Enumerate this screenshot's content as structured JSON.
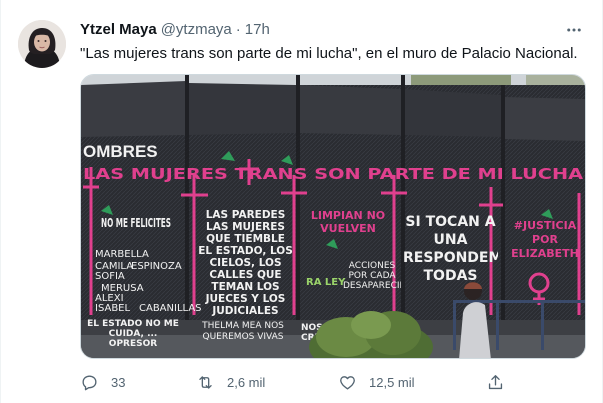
{
  "tweet": {
    "display_name": "Ytzel Maya",
    "handle": "@ytzmaya",
    "separator": "·",
    "time": "17h",
    "text": "\"Las mujeres trans son parte de mi lucha\", en el muro de Palacio Nacional."
  },
  "media": {
    "wall_texts": {
      "top_left": "OMBRES",
      "banner": "LAS MUJERES TRANS SON PARTE DE MI LUCHA",
      "no_me_felicites": "NO ME FELICITES",
      "names": [
        "MARBELLA",
        "CAMILA",
        "ESPINOZA",
        "SOFIA",
        "MERUSA",
        "ALEXI",
        "ISABEL",
        "CABANILLAS"
      ],
      "las_paredes": "LAS PAREDES LAS MUJERES QUE TIEMBLE EL ESTADO, LOS CIELOS, LOS CALLES QUE TEMAN LOS JUECES Y LOS JUDICIALES",
      "limpian": "LIMPIAN NO VUELVEN",
      "si_tocan": "SI TOCAN A UNA RESPONDEMOS TODAS",
      "justicia": "#JUSTICIA POR ELIZABETH",
      "bottom_left": "EL ESTADO NO ME CUIDA, ... OPRESOR",
      "vivas": "THELMA MEA NOS QUEREMOS VIVAS",
      "nos_crecer": "NOS CRECER",
      "pink_left": "RA LEY",
      "acciones": "ACCIONES POR CADA DESAPARECIDA"
    },
    "colors": {
      "pink": "#e0408e",
      "white_paint": "#f2f2f2",
      "fence": "#2b2d33",
      "sky": "#dfe3e6",
      "tree": "#5c7a3a"
    }
  },
  "actions": {
    "reply_count": "33",
    "retweet_count": "2,6 mil",
    "like_count": "12,5 mil",
    "reply_icon": "reply-icon",
    "retweet_icon": "retweet-icon",
    "like_icon": "heart-icon",
    "share_icon": "share-icon"
  }
}
